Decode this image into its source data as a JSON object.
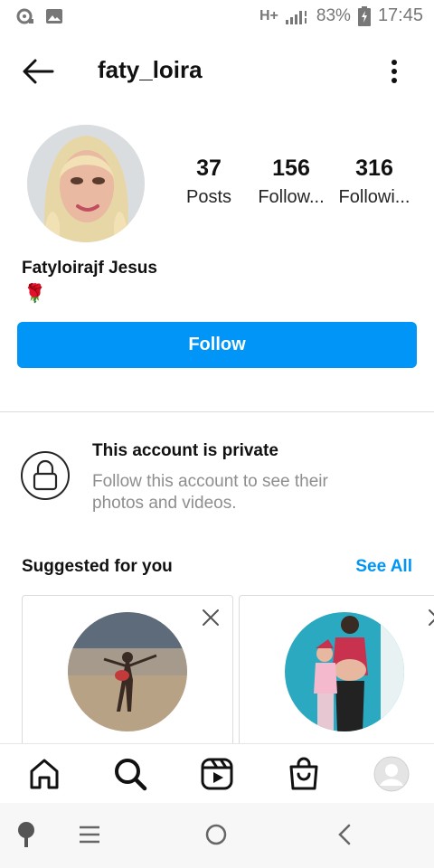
{
  "status_bar": {
    "network": "H+",
    "battery": "83%",
    "time": "17:45"
  },
  "header": {
    "username": "faty_loira"
  },
  "profile": {
    "stats": [
      {
        "num": "37",
        "label": "Posts"
      },
      {
        "num": "156",
        "label": "Follow..."
      },
      {
        "num": "316",
        "label": "Followi..."
      }
    ],
    "full_name": "Fatyloirajf Jesus",
    "bio_emoji": "🌹",
    "follow_label": "Follow"
  },
  "private": {
    "title": "This account is private",
    "description": "Follow this account to see their photos and videos."
  },
  "suggested": {
    "title": "Suggested for you",
    "see_all": "See All"
  },
  "colors": {
    "accent": "#0095f6",
    "muted_text": "#8e8e8e",
    "divider": "#dbdbdb"
  },
  "icons": {
    "bottom_nav": [
      "home-icon",
      "search-icon",
      "reels-icon",
      "shop-icon",
      "profile-avatar-icon"
    ],
    "system_nav": [
      "assistant-icon",
      "recents-icon",
      "home-circle-icon",
      "back-chevron-icon"
    ]
  }
}
